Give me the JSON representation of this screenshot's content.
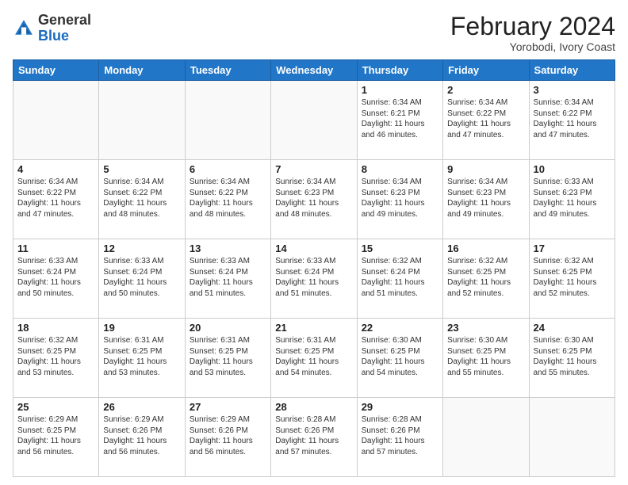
{
  "header": {
    "logo_general": "General",
    "logo_blue": "Blue",
    "main_title": "February 2024",
    "subtitle": "Yorobodi, Ivory Coast"
  },
  "calendar": {
    "days_of_week": [
      "Sunday",
      "Monday",
      "Tuesday",
      "Wednesday",
      "Thursday",
      "Friday",
      "Saturday"
    ],
    "weeks": [
      [
        {
          "day": "",
          "info": ""
        },
        {
          "day": "",
          "info": ""
        },
        {
          "day": "",
          "info": ""
        },
        {
          "day": "",
          "info": ""
        },
        {
          "day": "1",
          "info": "Sunrise: 6:34 AM\nSunset: 6:21 PM\nDaylight: 11 hours\nand 46 minutes."
        },
        {
          "day": "2",
          "info": "Sunrise: 6:34 AM\nSunset: 6:22 PM\nDaylight: 11 hours\nand 47 minutes."
        },
        {
          "day": "3",
          "info": "Sunrise: 6:34 AM\nSunset: 6:22 PM\nDaylight: 11 hours\nand 47 minutes."
        }
      ],
      [
        {
          "day": "4",
          "info": "Sunrise: 6:34 AM\nSunset: 6:22 PM\nDaylight: 11 hours\nand 47 minutes."
        },
        {
          "day": "5",
          "info": "Sunrise: 6:34 AM\nSunset: 6:22 PM\nDaylight: 11 hours\nand 48 minutes."
        },
        {
          "day": "6",
          "info": "Sunrise: 6:34 AM\nSunset: 6:22 PM\nDaylight: 11 hours\nand 48 minutes."
        },
        {
          "day": "7",
          "info": "Sunrise: 6:34 AM\nSunset: 6:23 PM\nDaylight: 11 hours\nand 48 minutes."
        },
        {
          "day": "8",
          "info": "Sunrise: 6:34 AM\nSunset: 6:23 PM\nDaylight: 11 hours\nand 49 minutes."
        },
        {
          "day": "9",
          "info": "Sunrise: 6:34 AM\nSunset: 6:23 PM\nDaylight: 11 hours\nand 49 minutes."
        },
        {
          "day": "10",
          "info": "Sunrise: 6:33 AM\nSunset: 6:23 PM\nDaylight: 11 hours\nand 49 minutes."
        }
      ],
      [
        {
          "day": "11",
          "info": "Sunrise: 6:33 AM\nSunset: 6:24 PM\nDaylight: 11 hours\nand 50 minutes."
        },
        {
          "day": "12",
          "info": "Sunrise: 6:33 AM\nSunset: 6:24 PM\nDaylight: 11 hours\nand 50 minutes."
        },
        {
          "day": "13",
          "info": "Sunrise: 6:33 AM\nSunset: 6:24 PM\nDaylight: 11 hours\nand 51 minutes."
        },
        {
          "day": "14",
          "info": "Sunrise: 6:33 AM\nSunset: 6:24 PM\nDaylight: 11 hours\nand 51 minutes."
        },
        {
          "day": "15",
          "info": "Sunrise: 6:32 AM\nSunset: 6:24 PM\nDaylight: 11 hours\nand 51 minutes."
        },
        {
          "day": "16",
          "info": "Sunrise: 6:32 AM\nSunset: 6:25 PM\nDaylight: 11 hours\nand 52 minutes."
        },
        {
          "day": "17",
          "info": "Sunrise: 6:32 AM\nSunset: 6:25 PM\nDaylight: 11 hours\nand 52 minutes."
        }
      ],
      [
        {
          "day": "18",
          "info": "Sunrise: 6:32 AM\nSunset: 6:25 PM\nDaylight: 11 hours\nand 53 minutes."
        },
        {
          "day": "19",
          "info": "Sunrise: 6:31 AM\nSunset: 6:25 PM\nDaylight: 11 hours\nand 53 minutes."
        },
        {
          "day": "20",
          "info": "Sunrise: 6:31 AM\nSunset: 6:25 PM\nDaylight: 11 hours\nand 53 minutes."
        },
        {
          "day": "21",
          "info": "Sunrise: 6:31 AM\nSunset: 6:25 PM\nDaylight: 11 hours\nand 54 minutes."
        },
        {
          "day": "22",
          "info": "Sunrise: 6:30 AM\nSunset: 6:25 PM\nDaylight: 11 hours\nand 54 minutes."
        },
        {
          "day": "23",
          "info": "Sunrise: 6:30 AM\nSunset: 6:25 PM\nDaylight: 11 hours\nand 55 minutes."
        },
        {
          "day": "24",
          "info": "Sunrise: 6:30 AM\nSunset: 6:25 PM\nDaylight: 11 hours\nand 55 minutes."
        }
      ],
      [
        {
          "day": "25",
          "info": "Sunrise: 6:29 AM\nSunset: 6:25 PM\nDaylight: 11 hours\nand 56 minutes."
        },
        {
          "day": "26",
          "info": "Sunrise: 6:29 AM\nSunset: 6:26 PM\nDaylight: 11 hours\nand 56 minutes."
        },
        {
          "day": "27",
          "info": "Sunrise: 6:29 AM\nSunset: 6:26 PM\nDaylight: 11 hours\nand 56 minutes."
        },
        {
          "day": "28",
          "info": "Sunrise: 6:28 AM\nSunset: 6:26 PM\nDaylight: 11 hours\nand 57 minutes."
        },
        {
          "day": "29",
          "info": "Sunrise: 6:28 AM\nSunset: 6:26 PM\nDaylight: 11 hours\nand 57 minutes."
        },
        {
          "day": "",
          "info": ""
        },
        {
          "day": "",
          "info": ""
        }
      ]
    ]
  }
}
